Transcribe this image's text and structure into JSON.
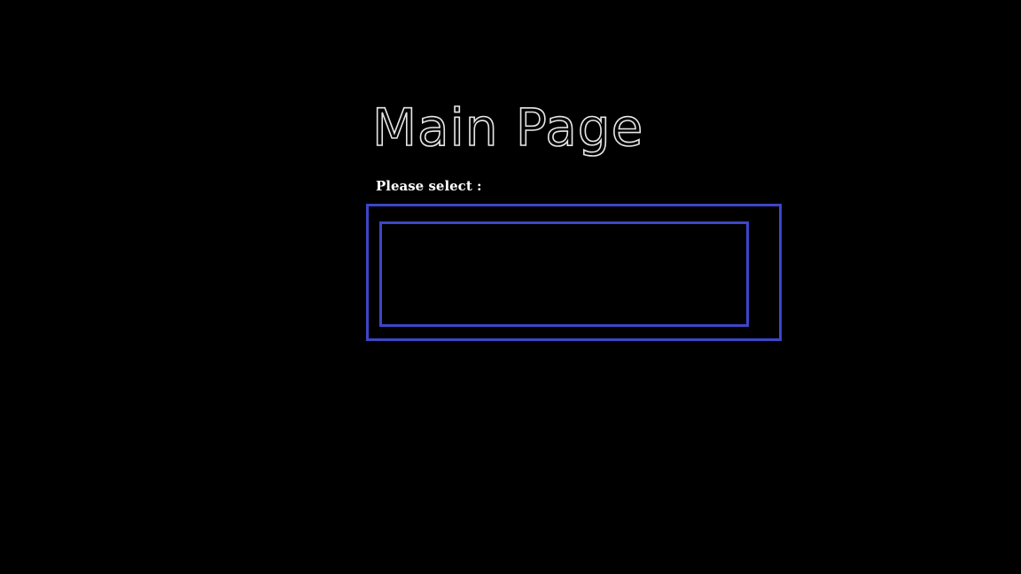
{
  "page": {
    "title": "Main Page",
    "select_label": "Please select :"
  },
  "select": {
    "value": "",
    "border_color": "#3d46c8"
  },
  "colors": {
    "background": "#000000",
    "title_outline": "#e6e6e6",
    "label_text": "#ffffff",
    "accent": "#3d46c8"
  }
}
